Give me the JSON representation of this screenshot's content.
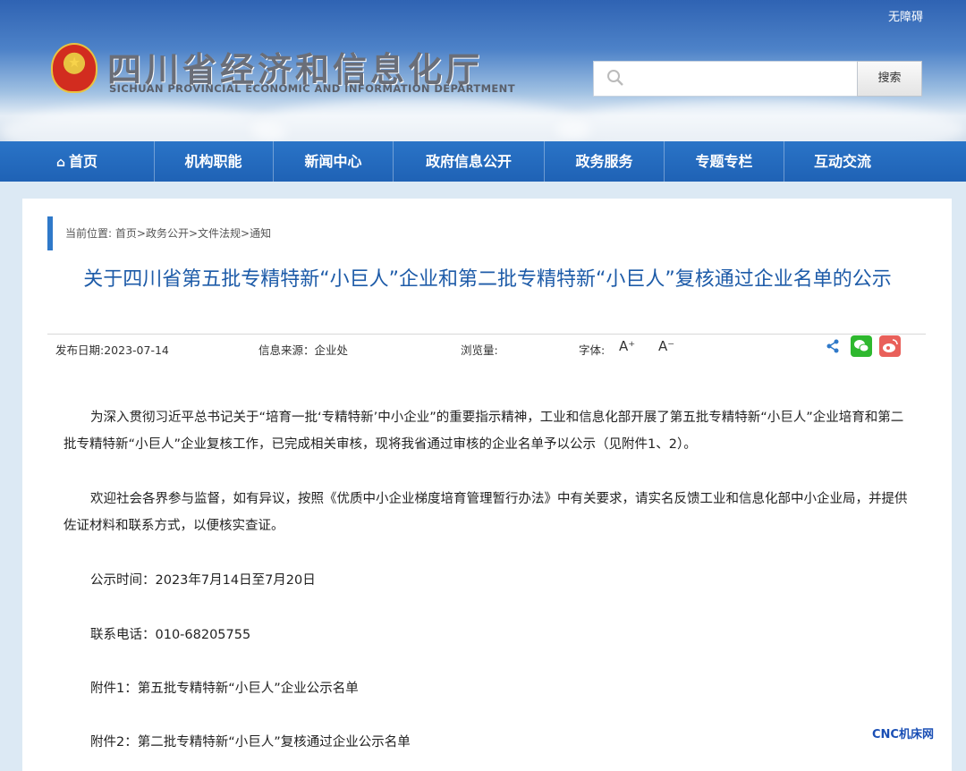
{
  "header": {
    "accessibility": "无障碍",
    "site_name_cn": "四川省经济和信息化厅",
    "site_name_en": "SICHUAN PROVINCIAL ECONOMIC AND INFORMATION DEPARTMENT",
    "search": {
      "placeholder": "",
      "button": "搜索"
    }
  },
  "nav": {
    "items": [
      "首页",
      "机构职能",
      "新闻中心",
      "政府信息公开",
      "政务服务",
      "专题专栏",
      "互动交流"
    ]
  },
  "breadcrumb": {
    "prefix": "当前位置:",
    "items": [
      "首页",
      "政务公开",
      "文件法规",
      "通知"
    ],
    "separator": ">"
  },
  "article": {
    "title": "关于四川省第五批专精特新“小巨人”企业和第二批专精特新“小巨人”复核通过企业名单的公示",
    "meta": {
      "date": "发布日期:2023-07-14",
      "source": "信息来源：企业处",
      "views": "浏览量:",
      "font_label": "字体:",
      "font_larger": "A⁺",
      "font_smaller": "A⁻"
    },
    "paragraphs": [
      "为深入贯彻习近平总书记关于“培育一批‘专精特新’中小企业”的重要指示精神，工业和信息化部开展了第五批专精特新“小巨人”企业培育和第二批专精特新“小巨人”企业复核工作，已完成相关审核，现将我省通过审核的企业名单予以公示（见附件1、2）。",
      "欢迎社会各界参与监督，如有异议，按照《优质中小企业梯度培育管理暂行办法》中有关要求，请实名反馈工业和信息化部中小企业局，并提供佐证材料和联系方式，以便核实查证。",
      "公示时间：2023年7月14日至7月20日",
      "联系电话：010-68205755",
      "附件1：第五批专精特新“小巨人”企业公示名单",
      "附件2：第二批专精特新“小巨人”复核通过企业公示名单"
    ]
  },
  "watermark": "CNC机床网",
  "icons": [
    "search-icon",
    "home-icon",
    "share-icon",
    "wechat-icon",
    "weibo-icon",
    "national-emblem"
  ]
}
